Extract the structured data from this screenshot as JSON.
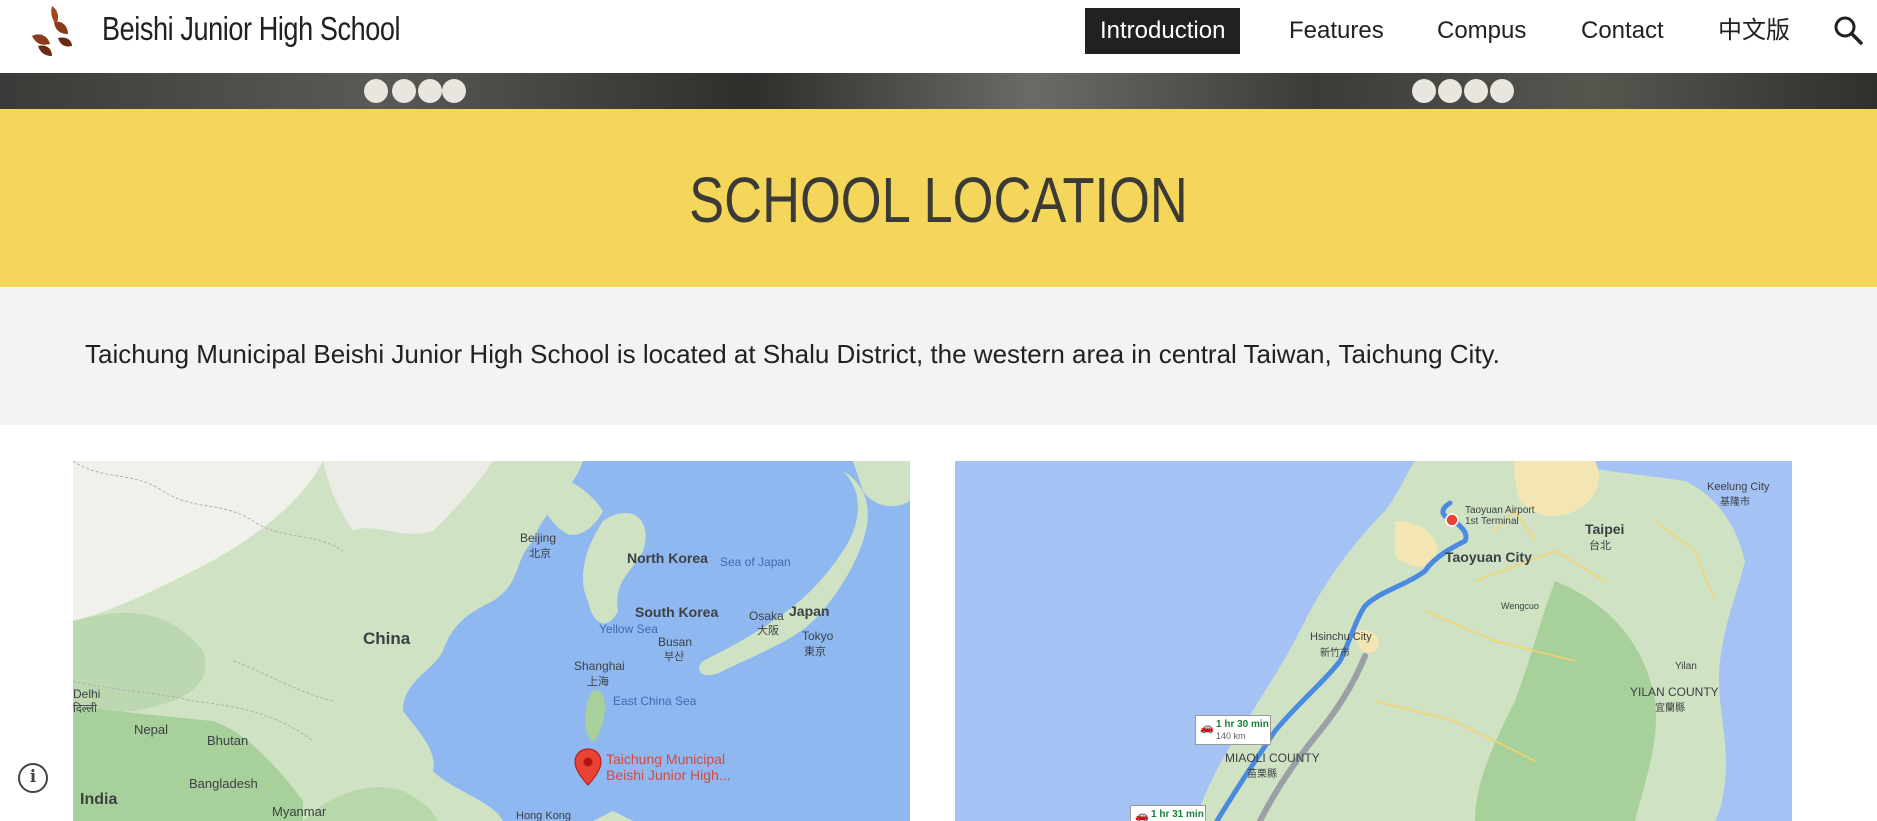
{
  "header": {
    "site_title": "Beishi Junior High School",
    "nav": [
      {
        "label": "Introduction",
        "active": true
      },
      {
        "label": "Features",
        "active": false
      },
      {
        "label": "Compus",
        "active": false
      },
      {
        "label": "Contact",
        "active": false
      },
      {
        "label": "中文版",
        "active": false
      }
    ],
    "search_icon": "search-icon",
    "logo_icon": "leaf-logo-icon"
  },
  "section": {
    "title": "SCHOOL LOCATION",
    "description": "Taichung  Municipal Beishi Junior High School is located at Shalu District, the western area in central Taiwan, Taichung City."
  },
  "map_left": {
    "labels": {
      "beijing": "Beijing",
      "beijing_zh": "北京",
      "north_korea": "North Korea",
      "sea_of_japan": "Sea of Japan",
      "south_korea": "South Korea",
      "yellow_sea": "Yellow Sea",
      "busan": "Busan",
      "busan_ko": "부산",
      "osaka": "Osaka",
      "osaka_ja": "大阪",
      "japan": "Japan",
      "tokyo": "Tokyo",
      "tokyo_ja": "東京",
      "china": "China",
      "shanghai": "Shanghai",
      "shanghai_zh": "上海",
      "east_china_sea": "East China Sea",
      "delhi": "Delhi",
      "delhi_hi": "दिल्ली",
      "nepal": "Nepal",
      "bhutan": "Bhutan",
      "bangladesh": "Bangladesh",
      "india": "India",
      "myanmar": "Myanmar",
      "hong_kong": "Hong Kong",
      "marker_line1": "Taichung Municipal",
      "marker_line2": "Beishi Junior High..."
    },
    "marker_icon": "map-pin-icon"
  },
  "map_right": {
    "labels": {
      "keelung": "Keelung City",
      "keelung_zh": "基隆市",
      "airport_line1": "Taoyuan Airport",
      "airport_line2": "1st Terminal",
      "taipei": "Taipei",
      "taipei_zh": "台北",
      "taoyuan": "Taoyuan City",
      "wengcuo": "Wengcuo",
      "hsinchu": "Hsinchu City",
      "hsinchu_zh": "新竹市",
      "yilan": "Yilan",
      "yilan_county": "YILAN COUNTY",
      "yilan_county_zh": "宜蘭縣",
      "miaoli": "MIAOLI COUNTY",
      "miaoli_zh": "苗栗縣",
      "route1_time": "1 hr 30 min",
      "route1_dist": "140 km",
      "route2_time": "1 hr 31 min"
    },
    "car_icon": "car-icon"
  },
  "colors": {
    "title_band": "#f4d75a",
    "desc_band": "#f3f3f3",
    "nav_active_bg": "#212121",
    "route_blue": "#4a8ae0"
  }
}
